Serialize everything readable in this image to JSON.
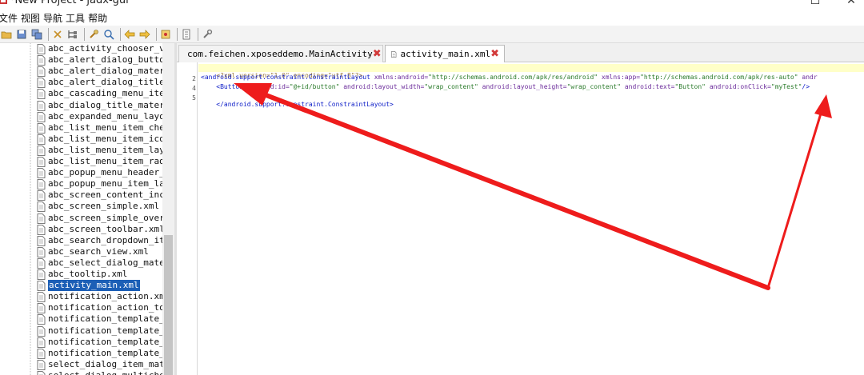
{
  "window": {
    "title": "*New Project - jadx-gui",
    "max_glyph": "☐",
    "close_glyph": "✕"
  },
  "menu": [
    "文件",
    "视图",
    "导航",
    "工具",
    "帮助"
  ],
  "toolbar_icons": [
    "open-icon",
    "save-icon",
    "save-all-icon",
    "sync-icon",
    "tree-icon",
    "search-icon",
    "find-icon",
    "back-icon",
    "forward-icon",
    "deobf-icon",
    "log-icon",
    "settings-icon"
  ],
  "tree": {
    "items": [
      "abc_activity_chooser_vie",
      "abc_alert_dialog_button_",
      "abc_alert_dialog_materia",
      "abc_alert_dialog_title_m",
      "abc_cascading_menu_item_",
      "abc_dialog_title_materia",
      "abc_expanded_menu_layout",
      "abc_list_menu_item_check",
      "abc_list_menu_item_icon.",
      "abc_list_menu_item_layou",
      "abc_list_menu_item_radic",
      "abc_popup_menu_header_it",
      "abc_popup_menu_item_layo",
      "abc_screen_content_inclu",
      "abc_screen_simple.xml",
      "abc_screen_simple_overla",
      "abc_screen_toolbar.xml",
      "abc_search_dropdown_item",
      "abc_search_view.xml",
      "abc_select_dialog_materi",
      "abc_tooltip.xml",
      "activity_main.xml",
      "notification_action.xml",
      "notification_action_tomb",
      "notification_template_cu",
      "notification_template_ic",
      "notification_template_pa",
      "notification_template_pa",
      "select_dialog_item_mater",
      "select_dialog_multichoic"
    ],
    "selected_index": 21
  },
  "tabs": [
    {
      "label": "com.feichen.xposeddemo.MainActivity",
      "icon": "class-icon"
    },
    {
      "label": "activity_main.xml",
      "icon": "file-icon"
    }
  ],
  "editor": {
    "line_numbers": [
      "2",
      "4",
      "5"
    ],
    "line1": "<?xml version=\"1.0\" encoding=\"utf-8\"?>",
    "line2_tag": "<android.support.constraint.ConstraintLayout",
    "line2_a1": " xmlns:android=",
    "line2_v1": "\"http://schemas.android.com/apk/res/android\"",
    "line2_a2": " xmlns:app=",
    "line2_v2": "\"http://schemas.android.com/apk/res-auto\"",
    "line2_a3": " andr",
    "line3_tag": "    <Button",
    "line3_a1": " android:id=",
    "line3_v1": "\"@+id/button\"",
    "line3_a2": " android:layout_width=",
    "line3_v2": "\"wrap_content\"",
    "line3_a3": " android:layout_height=",
    "line3_v3": "\"wrap_content\"",
    "line3_a4": " android:text=",
    "line3_v4": "\"Button\"",
    "line3_a5": " android:onClick=",
    "line3_v5": "\"myTest\"",
    "line3_end": "/>",
    "line4": "</android.support.constraint.ConstraintLayout>"
  },
  "colors": {
    "annotation_arrow": "#ee1c1c",
    "selection": "#1c5fb6"
  }
}
